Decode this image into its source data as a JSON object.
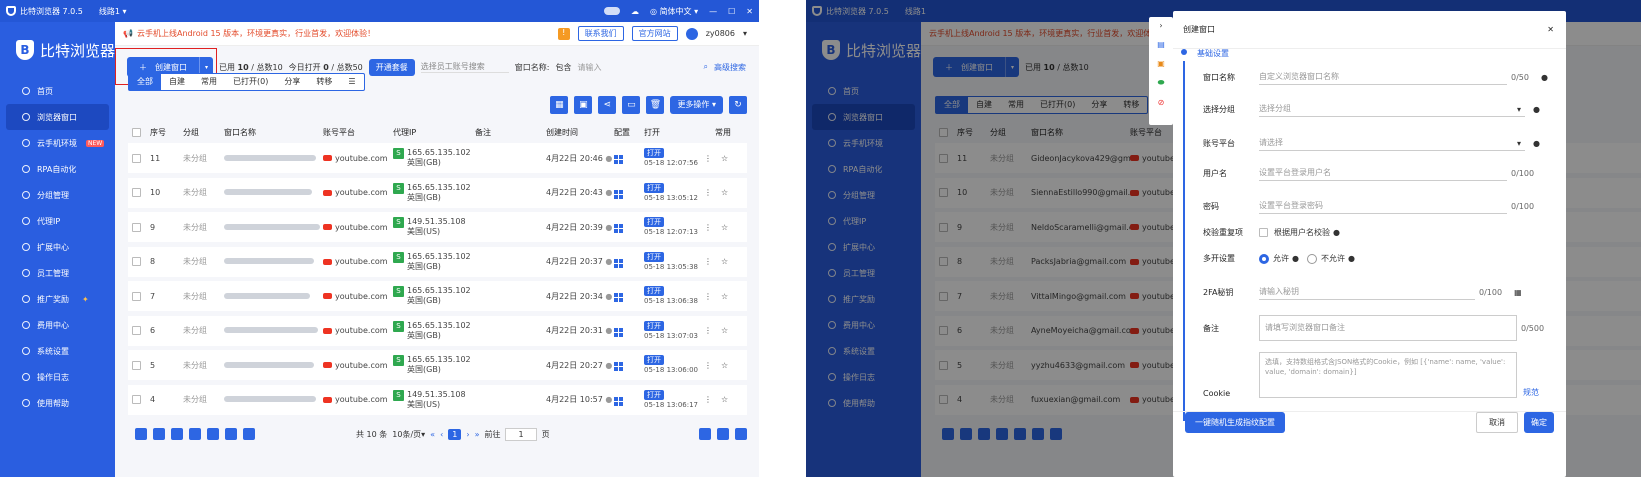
{
  "app": {
    "title": "比特浏览器 7.0.5",
    "line": "线路1",
    "lang": "简体中文",
    "brand": "比特浏览器"
  },
  "nav": [
    "首页",
    "浏览器窗口",
    "云手机环境",
    "RPA自动化",
    "分组管理",
    "代理IP",
    "扩展中心",
    "员工管理",
    "推广奖励",
    "费用中心",
    "系统设置",
    "操作日志",
    "使用帮助"
  ],
  "new_badge": "NEW",
  "notice": "云手机上线Android 15 版本，环境更真实，行业首发，欢迎体验！",
  "header": {
    "contact": "联系我们",
    "site": "官方网站",
    "user": "zy0806"
  },
  "toolbar": {
    "create": "创建窗口",
    "stats_left": "已用",
    "used": "10",
    "total_label": "/ 总数",
    "total": "10",
    "today_label": "今日打开",
    "today": "0",
    "today_total": "/ 总数50",
    "open_pkg": "开通套餐",
    "staff_placeholder": "选择员工账号搜索",
    "name_label": "窗口名称:",
    "contains": "包含",
    "input_placeholder": "请输入",
    "adv": "高级搜索"
  },
  "tabs": [
    "全部",
    "自建",
    "常用",
    "已打开(0)",
    "分享",
    "转移"
  ],
  "more": "更多操作",
  "cols": [
    "序号",
    "分组",
    "窗口名称",
    "账号平台",
    "代理IP",
    "备注",
    "创建时间",
    "配置",
    "打开",
    "常用"
  ],
  "group_val": "未分组",
  "platform": "youtube.com",
  "open_label": "打开",
  "rows": [
    {
      "no": "11",
      "ip": "165.65.135.102",
      "country": "英国(GB)",
      "created": "4月22日 20:46",
      "opened": "05-18 12:07:56",
      "email": "GideonJacykova429@gm..."
    },
    {
      "no": "10",
      "ip": "165.65.135.102",
      "country": "英国(GB)",
      "created": "4月22日 20:43",
      "opened": "05-18 13:05:12",
      "email": "SiennaEstillo990@gmail.c..."
    },
    {
      "no": "9",
      "ip": "149.51.35.108",
      "country": "美国(US)",
      "created": "4月22日 20:39",
      "opened": "05-18 12:07:13",
      "email": "NeldoScaramelli@gmail.c..."
    },
    {
      "no": "8",
      "ip": "165.65.135.102",
      "country": "英国(GB)",
      "created": "4月22日 20:37",
      "opened": "05-18 13:05:38",
      "email": "PacksJabria@gmail.com"
    },
    {
      "no": "7",
      "ip": "165.65.135.102",
      "country": "英国(GB)",
      "created": "4月22日 20:34",
      "opened": "05-18 13:06:38",
      "email": "VittalMingo@gmail.com"
    },
    {
      "no": "6",
      "ip": "165.65.135.102",
      "country": "英国(GB)",
      "created": "4月22日 20:31",
      "opened": "05-18 13:07:03",
      "email": "AyneMoyeicha@gmail.com"
    },
    {
      "no": "5",
      "ip": "165.65.135.102",
      "country": "英国(GB)",
      "created": "4月22日 20:27",
      "opened": "05-18 13:06:00",
      "email": "yyzhu4633@gmail.com"
    },
    {
      "no": "4",
      "ip": "149.51.35.108",
      "country": "美国(US)",
      "created": "4月22日 10:57",
      "opened": "05-18 13:06:17",
      "email": "fuxuexian@gmail.com"
    }
  ],
  "pager": {
    "total": "共 10 条",
    "per": "10条/页",
    "page": "1",
    "goto": "前往",
    "page_input": "1",
    "page_suffix": "页"
  },
  "dialog": {
    "title": "创建窗口",
    "section": "基础设置",
    "name_label": "窗口名称",
    "name_ph": "自定义浏览器窗口名称",
    "name_count": "0/50",
    "group_label": "选择分组",
    "group_ph": "选择分组",
    "platform_label": "账号平台",
    "platform_ph": "请选择",
    "user_label": "用户名",
    "user_ph": "设置平台登录用户名",
    "user_count": "0/100",
    "pwd_label": "密码",
    "pwd_ph": "设置平台登录密码",
    "pwd_count": "0/100",
    "dup_label": "校验重复项",
    "dup_check": "根据用户名校验",
    "multi_label": "多开设置",
    "allow": "允许",
    "deny": "不允许",
    "fa_label": "2FA秘钥",
    "fa_ph": "请输入秘钥",
    "fa_count": "0/100",
    "remark_label": "备注",
    "remark_ph": "请填写浏览器窗口备注",
    "remark_count": "0/500",
    "cookie_label": "Cookie",
    "cookie_ph": "选填，支持数组格式含JSON格式的Cookie，例如 [{'name': name, 'value': value, 'domain': domain}]",
    "cookie_link": "规范",
    "gen": "一键随机生成指纹配置",
    "cancel": "取消",
    "ok": "确定"
  },
  "colors": {
    "primary": "#2d66e3",
    "sidebar": "#2a5ee0",
    "highlight": "#e02020"
  }
}
